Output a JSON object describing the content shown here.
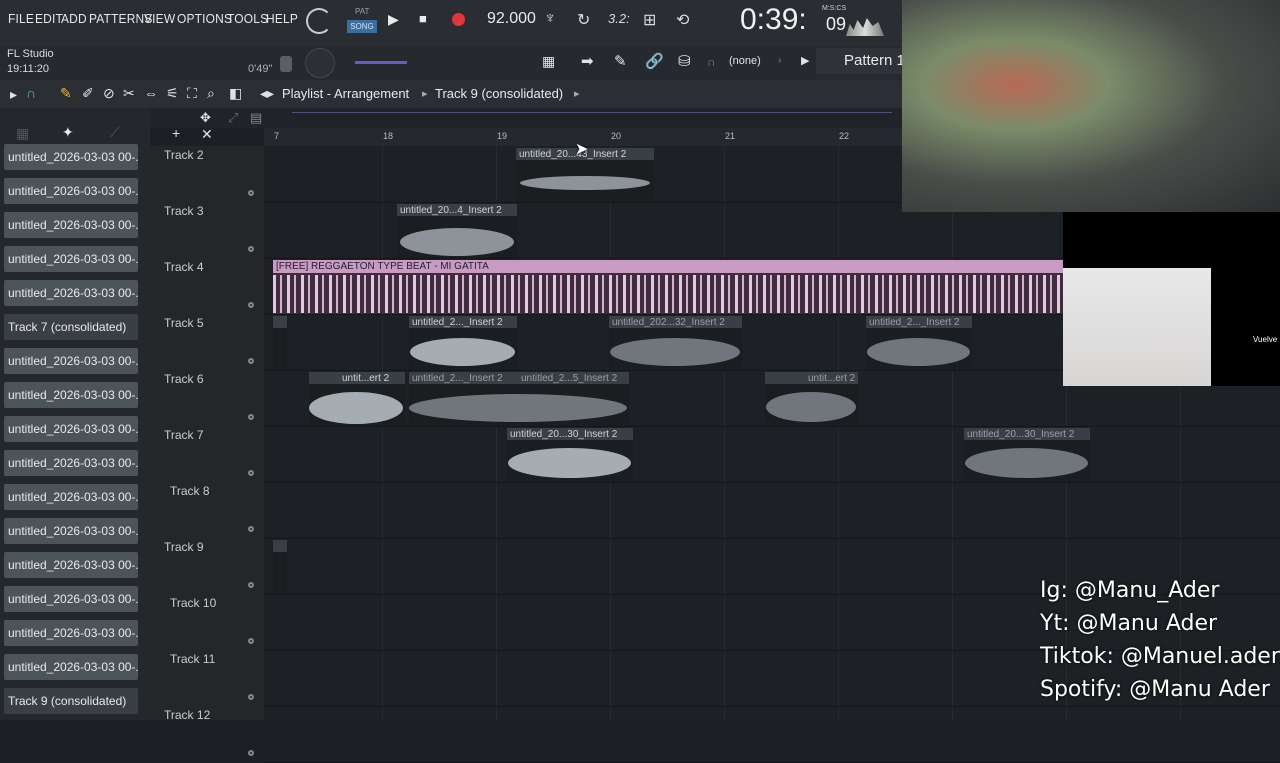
{
  "menu": [
    "FILE",
    "EDIT",
    "ADD",
    "PATTERNS",
    "VIEW",
    "OPTIONS",
    "TOOLS",
    "HELP"
  ],
  "transport": {
    "pat": "PAT",
    "song": "SONG",
    "tempo": "92.000",
    "time": "0:39:",
    "time_small": "09",
    "time_label": "M:S:CS",
    "small_disp": "3.2:"
  },
  "info": {
    "app": "FL Studio",
    "clock": "19:11:20",
    "duration": "0'49\""
  },
  "toolbar": {
    "none_label": "(none)",
    "pattern": "Pattern 1"
  },
  "playlist": {
    "title": "Playlist - Arrangement",
    "breadcrumb": "Track 9 (consolidated)"
  },
  "ruler": [
    "7",
    "18",
    "19",
    "20",
    "21",
    "22"
  ],
  "patterns": [
    "untitled_2026-03-03 00-...",
    "untitled_2026-03-03 00-...",
    "untitled_2026-03-03 00-...",
    "untitled_2026-03-03 00-...",
    "untitled_2026-03-03 00-...",
    "Track 7 (consolidated)",
    "untitled_2026-03-03 00-...",
    "untitled_2026-03-03 00-...",
    "untitled_2026-03-03 00-...",
    "untitled_2026-03-03 00-...",
    "untitled_2026-03-03 00-...",
    "untitled_2026-03-03 00-...",
    "untitled_2026-03-03 00-...",
    "untitled_2026-03-03 00-...",
    "untitled_2026-03-03 00-...",
    "untitled_2026-03-03 00-...",
    "Track 9 (consolidated)"
  ],
  "tracks": [
    "Track 2",
    "Track 3",
    "Track 4",
    "Track 5",
    "Track 6",
    "Track 7",
    "Track 8",
    "Track 9",
    "Track 10",
    "Track 11",
    "Track 12"
  ],
  "clips": {
    "t2": "untitled_20...43_Insert 2",
    "t3": "untitled_20...4_Insert 2",
    "t4": "[FREE] REGGAETON TYPE BEAT - MI GATITA",
    "t5a": "untitled_2..._Insert 2",
    "t5b": "untitled_202...32_Insert 2",
    "t5c": "untitled_2..._Insert 2",
    "t6a": "untit...ert 2",
    "t6b": "untitled_2..._Insert 2",
    "t6c": "untitled_2...5_Insert 2",
    "t6d": "untit...ert 2",
    "t7a": "untitled_20...30_Insert 2",
    "t7b": "untitled_20...30_Insert 2"
  },
  "social": [
    "Ig: @Manu_Ader",
    "Yt: @Manu Ader",
    "Tiktok: @Manuel.ader",
    "Spotify: @Manu Ader"
  ],
  "side_text": "Vuelve"
}
